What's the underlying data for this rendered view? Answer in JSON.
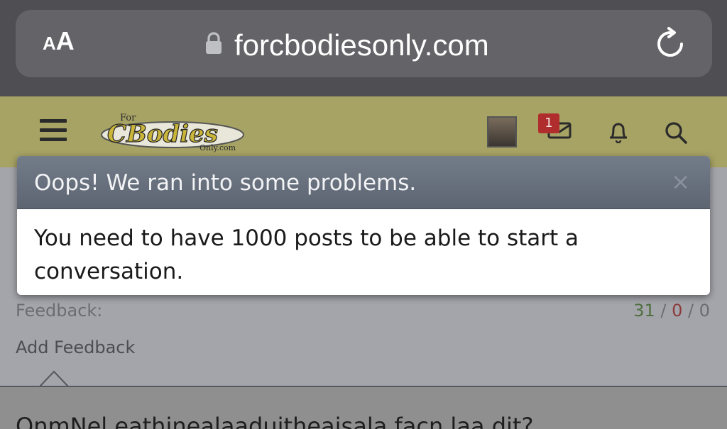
{
  "browser": {
    "aa_small": "A",
    "aa_large": "A",
    "url": "forcbodiesonly.com",
    "icons": [
      "lock-icon",
      "reload-icon"
    ]
  },
  "header": {
    "logo_text_top": "For",
    "logo_text_main": "CBodies",
    "logo_text_bottom": "Only.com",
    "inbox_badge": "1",
    "icons": [
      "hamburger-menu-icon",
      "avatar",
      "inbox-icon",
      "bell-icon",
      "search-icon"
    ],
    "accent_color": "#a7a365"
  },
  "dialog": {
    "title": "Oops! We ran into some problems.",
    "close_label": "×",
    "message": "You need to have 1000 posts to be able to start a conversation."
  },
  "profile": {
    "feedback_label": "Feedback:",
    "feedback_positive": "31",
    "feedback_neutral": "0",
    "feedback_negative": "0",
    "separator": " / ",
    "add_feedback": "Add Feedback"
  },
  "below": {
    "cut_text": "OnmNel  eathinealaaduitheaisala facn  laa  dit?"
  }
}
